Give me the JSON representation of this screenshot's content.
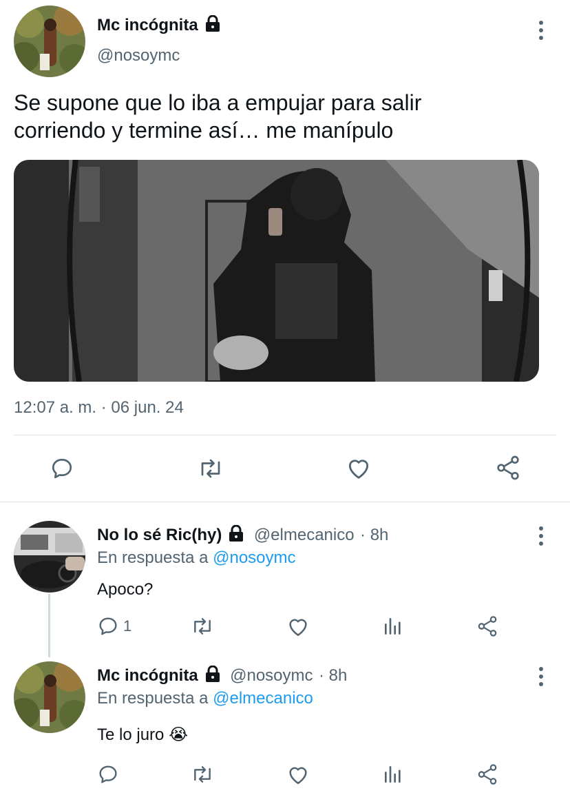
{
  "main_tweet": {
    "author_name": "Mc incógnita",
    "handle": "@nosoymc",
    "text_line1": "Se supone que lo iba a empujar para salir",
    "text_line2": "corriendo y termine así… me manípulo",
    "timestamp": "12:07 a. m. · 06 jun. 24",
    "actions": [
      "reply-icon",
      "retweet-icon",
      "like-icon",
      "share-icon"
    ]
  },
  "replies": [
    {
      "author_name": "No lo sé Ric(hy)",
      "handle": "@elmecanico",
      "time": "· 8h",
      "reply_prefix": "En respuesta a",
      "reply_to": "@nosoymc",
      "text": "Apoco?",
      "reply_count": "1"
    },
    {
      "author_name": "Mc incógnita",
      "handle": "@nosoymc",
      "time": "· 8h",
      "reply_prefix": "En respuesta a",
      "reply_to": "@elmecanico",
      "text": "Te lo juro",
      "emoji": "😭"
    }
  ],
  "colors": {
    "text": "#0f1419",
    "secondary": "#536471",
    "link": "#1d9bf0",
    "divider": "#dde2e6"
  }
}
